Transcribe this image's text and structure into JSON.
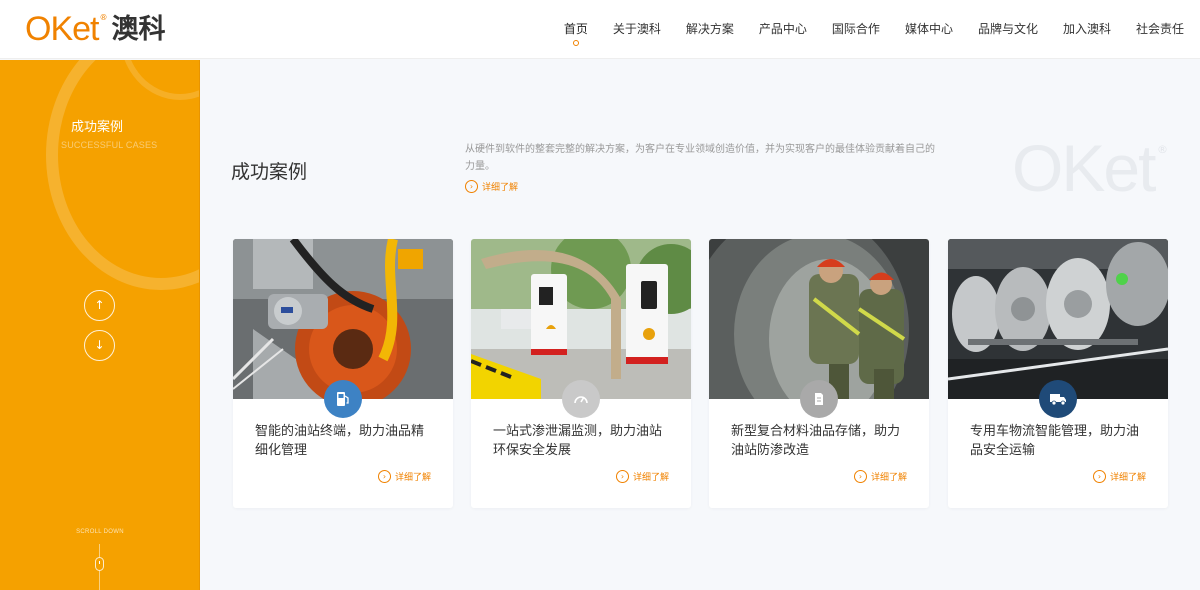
{
  "logo": {
    "en": "OKet",
    "reg": "®",
    "cn": "澳科"
  },
  "nav": {
    "items": [
      {
        "label": "首页",
        "active": true
      },
      {
        "label": "关于澳科"
      },
      {
        "label": "解决方案"
      },
      {
        "label": "产品中心"
      },
      {
        "label": "国际合作"
      },
      {
        "label": "媒体中心"
      },
      {
        "label": "品牌与文化"
      },
      {
        "label": "加入澳科"
      },
      {
        "label": "社会责任"
      }
    ]
  },
  "sidebar": {
    "title": "成功案例",
    "subtitle": "SUCCESSFUL CASES",
    "up_icon": "↑",
    "down_icon": "↓",
    "scroll_text": "SCROLL DOWN"
  },
  "section": {
    "title": "成功案例",
    "description": "从硬件到软件的整套完整的解决方案，为客户在专业领域创造价值，并为实现客户的最佳体验贡献着自己的力量。",
    "more": "详细了解",
    "bg_logo": "OKet",
    "bg_logo_reg": "®"
  },
  "cards": [
    {
      "title": "智能的油站终端，助力油品精细化管理",
      "more": "详细了解",
      "icon": "fuel-pump-icon",
      "icon_color": "#3d82c4"
    },
    {
      "title": "一站式渗泄漏监测，助力油站环保安全发展",
      "more": "详细了解",
      "icon": "gauge-icon",
      "icon_color": "#c9c9c9"
    },
    {
      "title": "新型复合材料油品存储，助力油站防渗改造",
      "more": "详细了解",
      "icon": "document-icon",
      "icon_color": "#a9a9a9"
    },
    {
      "title": "专用车物流智能管理，助力油品安全运输",
      "more": "详细了解",
      "icon": "truck-icon",
      "icon_color": "#1f4a78"
    }
  ],
  "colors": {
    "accent": "#f08200",
    "sidebar": "#f5a100"
  }
}
